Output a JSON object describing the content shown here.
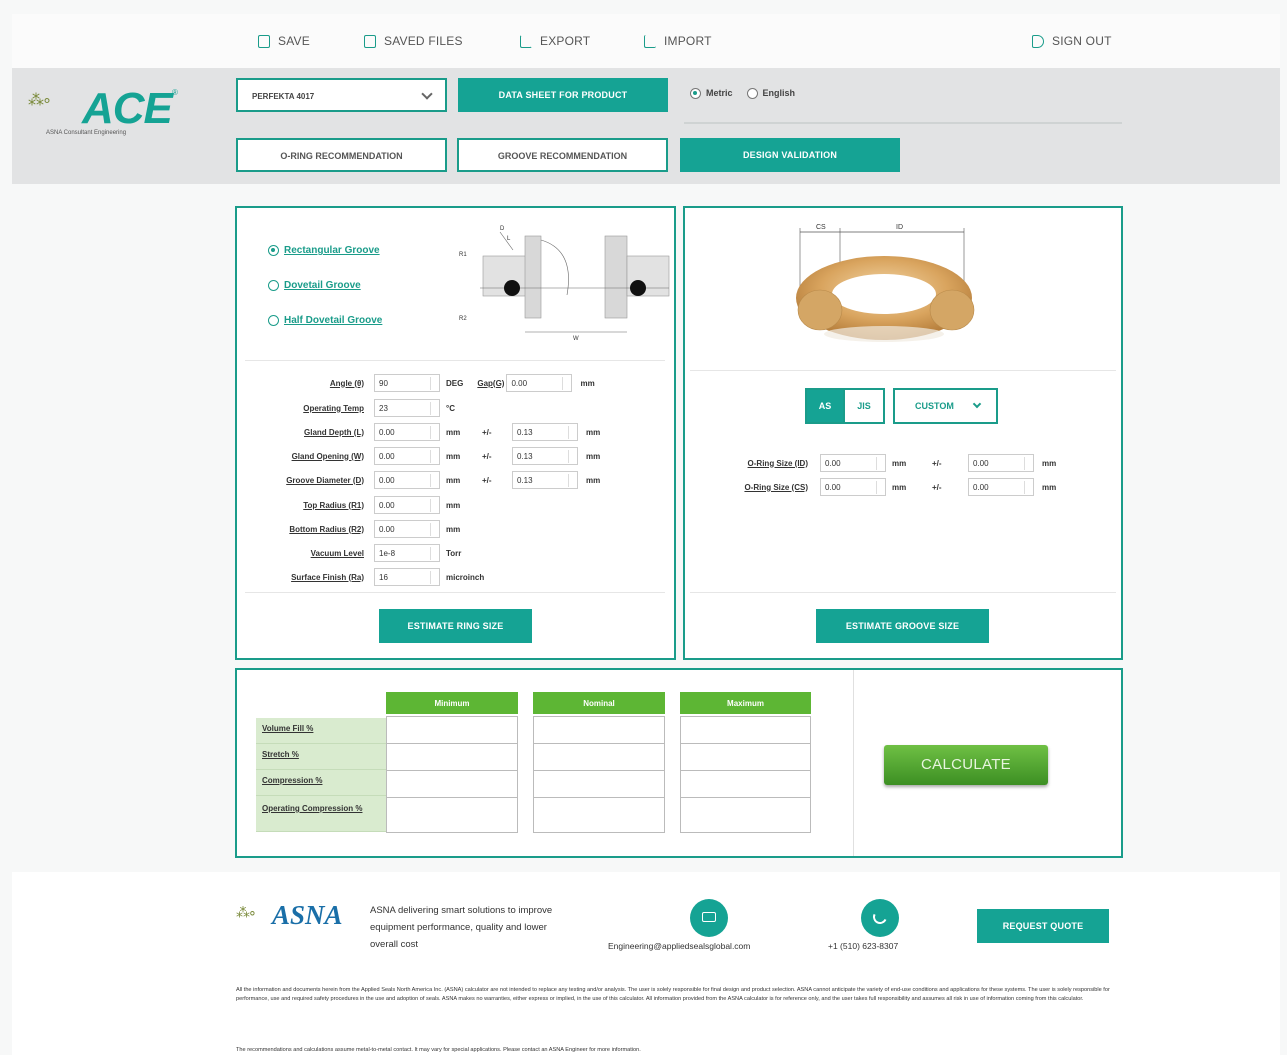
{
  "nav": {
    "save": "SAVE",
    "saved_files": "SAVED FILES",
    "export": "EXPORT",
    "import": "IMPORT",
    "sign_out": "SIGN OUT"
  },
  "brand": {
    "logo_text": "ACE",
    "logo_sub": "ASNA Consultant Engineering"
  },
  "toolbar": {
    "compound_select": "PERFEKTA 4017",
    "datasheet_button": "DATA SHEET FOR PRODUCT",
    "units": [
      {
        "label": "Metric",
        "selected": true
      },
      {
        "label": "English",
        "selected": false
      }
    ]
  },
  "tabs": [
    {
      "label": "O-RING RECOMMENDATION",
      "active": false
    },
    {
      "label": "GROOVE RECOMMENDATION",
      "active": false
    },
    {
      "label": "DESIGN VALIDATION",
      "active": true
    }
  ],
  "groove_types": [
    {
      "label": "Rectangular Groove",
      "selected": true
    },
    {
      "label": "Dovetail Groove",
      "selected": false
    },
    {
      "label": "Half Dovetail Groove",
      "selected": false
    }
  ],
  "diagram": {
    "labels": [
      "ID",
      "W",
      "CS",
      "R1",
      "R2",
      "D",
      "L",
      "W"
    ]
  },
  "groove_fields": [
    {
      "label": "Angle (θ)",
      "value": "90",
      "unit": "DEG",
      "extra_label": "Gap(G)",
      "extra_value": "0.00",
      "extra_unit": "mm"
    },
    {
      "label": "Operating Temp",
      "value": "23",
      "unit": "°C"
    },
    {
      "label": "Gland Depth (L)",
      "value": "0.00",
      "unit": "mm",
      "tol_sign": "+/-",
      "tol_value": "0.13",
      "tol_unit": "mm"
    },
    {
      "label": "Gland Opening (W)",
      "value": "0.00",
      "unit": "mm",
      "tol_sign": "+/-",
      "tol_value": "0.13",
      "tol_unit": "mm"
    },
    {
      "label": "Groove Diameter (D)",
      "value": "0.00",
      "unit": "mm",
      "tol_sign": "+/-",
      "tol_value": "0.13",
      "tol_unit": "mm"
    },
    {
      "label": "Top Radius (R1)",
      "value": "0.00",
      "unit": "mm"
    },
    {
      "label": "Bottom Radius (R2)",
      "value": "0.00",
      "unit": "mm"
    },
    {
      "label": "Vacuum Level",
      "value": "1e-8",
      "unit": "Torr"
    },
    {
      "label": "Surface Finish (Ra)",
      "value": "16",
      "unit": "microinch"
    }
  ],
  "estimate_ring_button": "ESTIMATE RING SIZE",
  "ring": {
    "dim_cs": "CS",
    "dim_id": "ID",
    "size_modes": [
      "AS",
      "JIS"
    ],
    "active_mode": "AS",
    "custom_select": "CUSTOM",
    "fields": [
      {
        "label": "O-Ring Size (ID)",
        "value": "0.00",
        "unit": "mm",
        "tol_sign": "+/-",
        "tol_value": "0.00",
        "tol_unit": "mm"
      },
      {
        "label": "O-Ring Size (CS)",
        "value": "0.00",
        "unit": "mm",
        "tol_sign": "+/-",
        "tol_value": "0.00",
        "tol_unit": "mm"
      }
    ]
  },
  "estimate_groove_button": "ESTIMATE GROOVE SIZE",
  "results": {
    "columns": [
      "Minimum",
      "Nominal",
      "Maximum"
    ],
    "rows": [
      "Volume Fill %",
      "Stretch %",
      "Compression %",
      "Operating Compression %"
    ]
  },
  "calculate_button": "CALCULATE",
  "footer": {
    "logo_text": "ASNA",
    "tagline": "ASNA delivering smart solutions to improve equipment performance, quality and lower overall cost",
    "email": "Engineering@appliedsealsglobal.com",
    "phone": "+1 (510) 623-8307",
    "quote_button": "REQUEST QUOTE",
    "disclaimer": "All the information and documents herein from the Applied Seals North America Inc. (ASNA) calculator are not intended to replace any testing and/or analysis. The user is solely responsible for final design and product selection. ASNA cannot anticipate the variety of end-use conditions and applications for these systems. The user is solely responsible for performance, use and required safety procedures in the use and adoption of seals. ASNA makes no warranties, either express or implied, in the use of this calculator. All information provided from the ASNA calculator is for reference only, and the user takes full responsibility and assumes all risk in use of information coming from this calculator.",
    "note": "The recommendations and calculations assume metal-to-metal contact. It may vary for special applications. Please contact an ASNA Engineer for more information."
  },
  "colors": {
    "teal": "#15a394",
    "green": "#5db634",
    "band": "#e2e3e4"
  }
}
